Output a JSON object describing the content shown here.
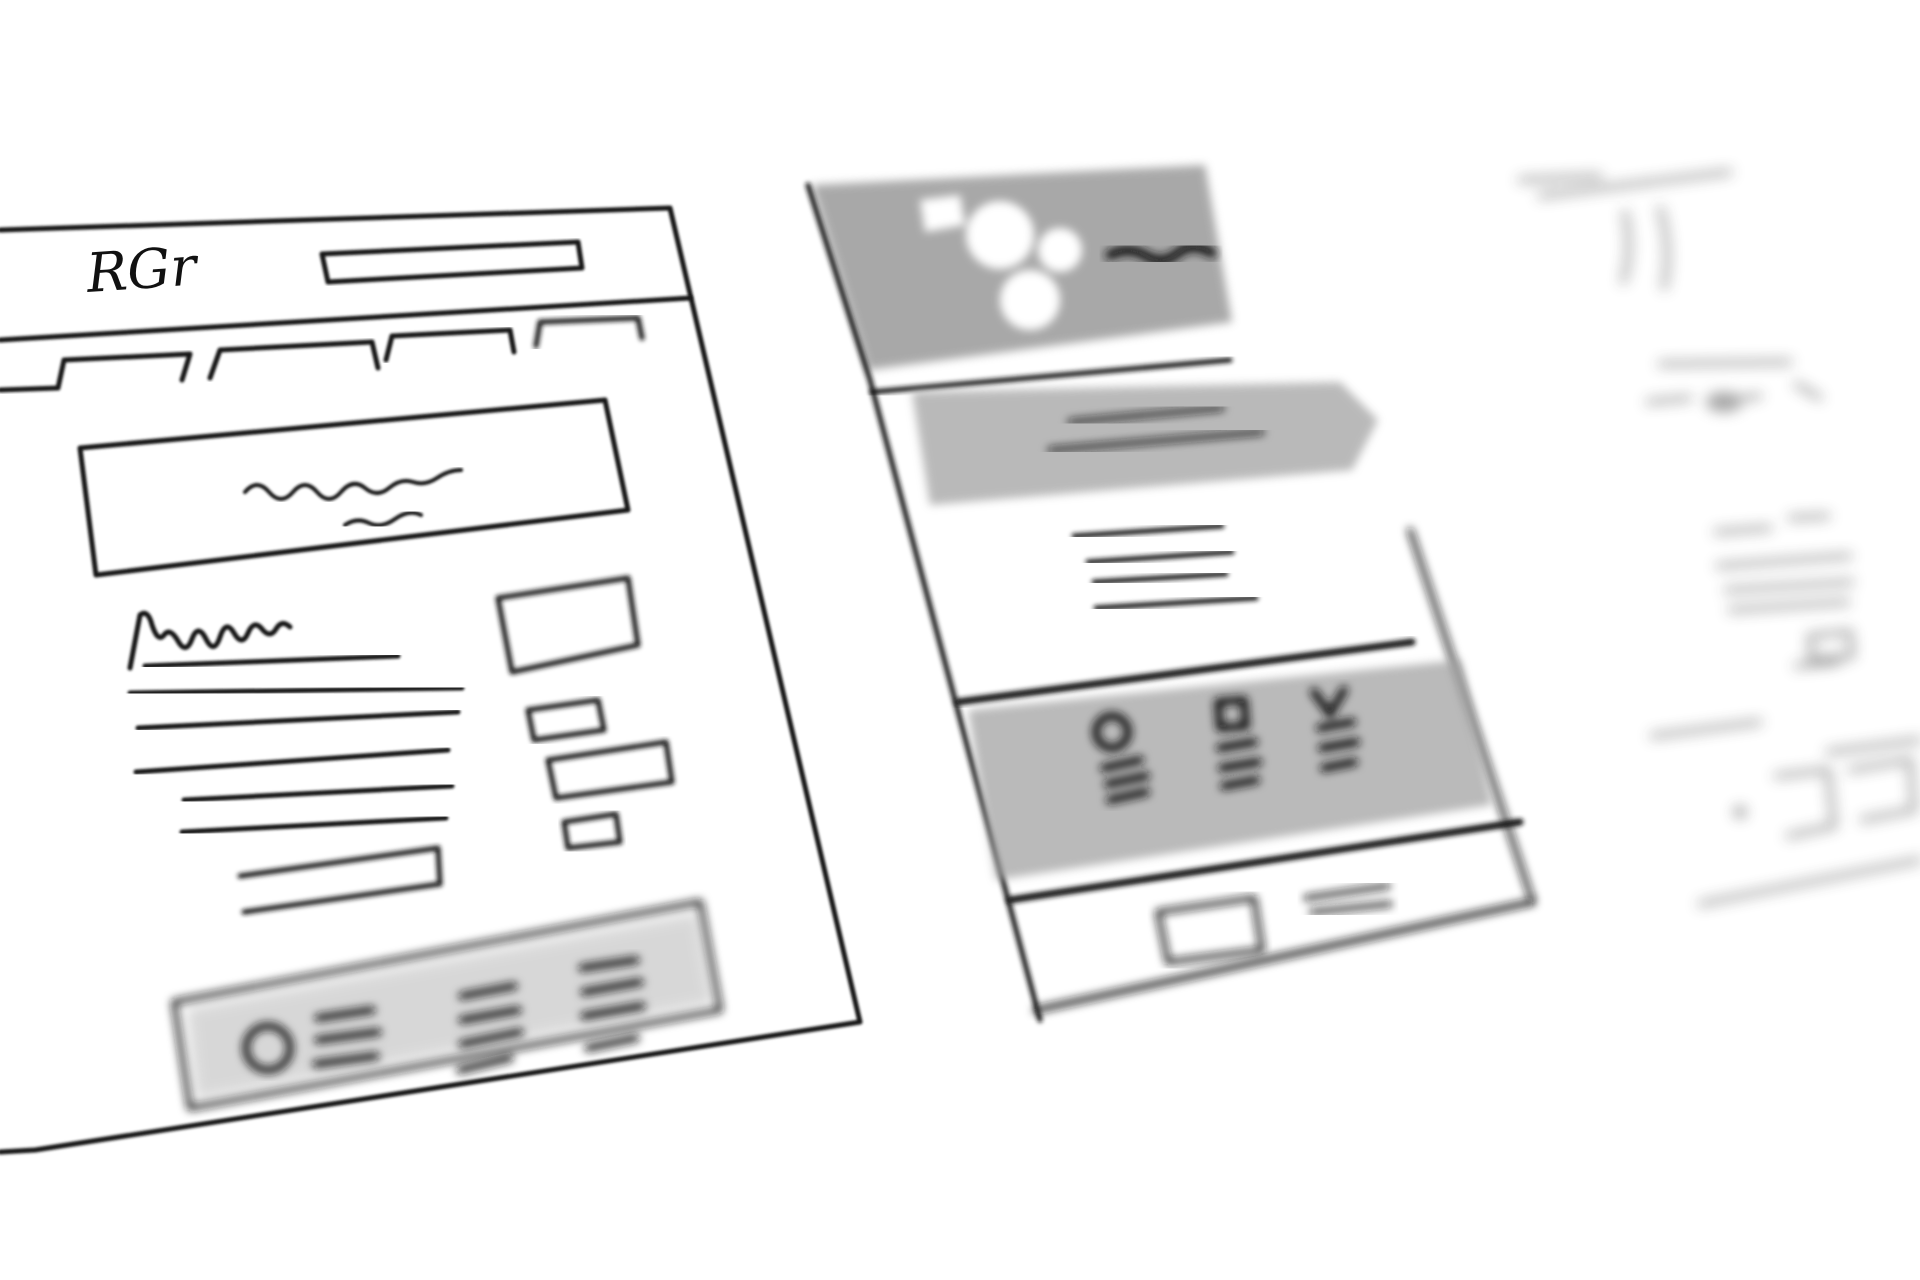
{
  "sketch": {
    "logo_text": "RGr",
    "palette": {
      "ink": "#141414",
      "paper": "#ffffff",
      "wash": "#8f8f8f",
      "wash_light": "#bdbdbd"
    },
    "frames": [
      {
        "name": "desktop-wireframe",
        "label": ""
      },
      {
        "name": "tablet-wireframe",
        "label": ""
      },
      {
        "name": "mobile-wireframe",
        "label": ""
      }
    ]
  }
}
